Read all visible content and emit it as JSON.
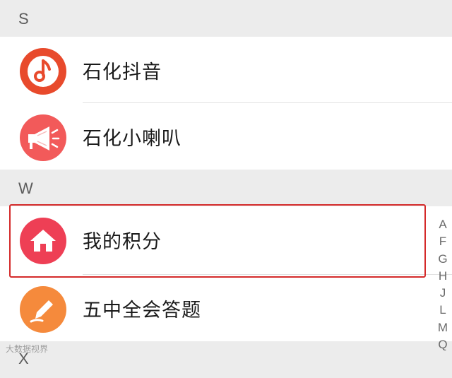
{
  "sections": [
    {
      "letter": "S"
    },
    {
      "letter": "W"
    },
    {
      "letter": "X"
    }
  ],
  "items": [
    {
      "label": "石化抖音",
      "icon": "music-note-icon",
      "color": "#e84a2c"
    },
    {
      "label": "石化小喇叭",
      "icon": "megaphone-icon",
      "color": "#f25a5a"
    },
    {
      "label": "我的积分",
      "icon": "home-icon",
      "color": "#ee3f55"
    },
    {
      "label": "五中全会答题",
      "icon": "pencil-icon",
      "color": "#f58a3c"
    }
  ],
  "index_bar": [
    "A",
    "F",
    "G",
    "H",
    "J",
    "L",
    "M",
    "Q"
  ],
  "watermark": "大数据视界",
  "highlight_color": "#d42a2a"
}
